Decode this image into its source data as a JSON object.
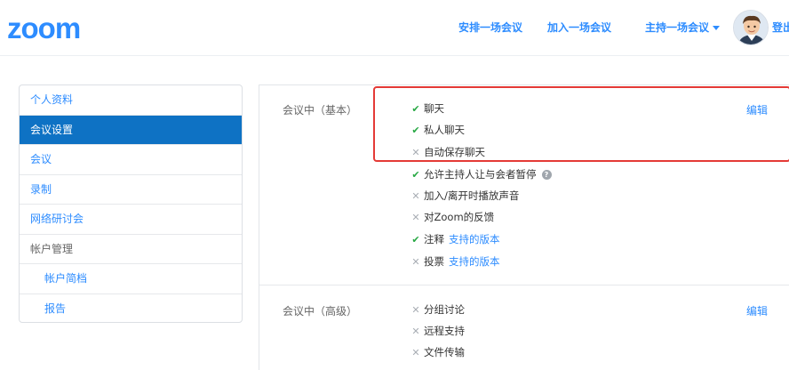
{
  "header": {
    "logo": "zoom",
    "nav": {
      "schedule": "安排一场会议",
      "join": "加入一场会议",
      "host": "主持一场会议"
    },
    "login": "登出"
  },
  "sidebar": {
    "items": [
      {
        "label": "个人资料"
      },
      {
        "label": "会议设置"
      },
      {
        "label": "会议"
      },
      {
        "label": "录制"
      },
      {
        "label": "网络研讨会"
      },
      {
        "label": "帐户管理"
      },
      {
        "label": "帐户简档"
      },
      {
        "label": "报告"
      }
    ]
  },
  "sections": {
    "basic": {
      "title": "会议中（基本）",
      "edit": "编辑",
      "options": [
        {
          "label": "聊天",
          "enabled": true
        },
        {
          "label": "私人聊天",
          "enabled": true
        },
        {
          "label": "自动保存聊天",
          "enabled": false
        },
        {
          "label": "允许主持人让与会者暂停",
          "enabled": true
        },
        {
          "label": "加入/离开时播放声音",
          "enabled": false
        },
        {
          "label": "对Zoom的反馈",
          "enabled": false
        },
        {
          "label": "注释",
          "enabled": true,
          "link": "支持的版本"
        },
        {
          "label": "投票",
          "enabled": false,
          "link": "支持的版本"
        }
      ]
    },
    "advanced": {
      "title": "会议中（高级）",
      "edit": "编辑",
      "options": [
        {
          "label": "分组讨论",
          "enabled": false
        },
        {
          "label": "远程支持",
          "enabled": false
        },
        {
          "label": "文件传输",
          "enabled": false
        }
      ]
    }
  },
  "help_mark": "?",
  "colors": {
    "brand": "#2d8cff",
    "active_nav": "#0e72c4",
    "enabled_check": "#27a843",
    "highlight_border": "#e43a36"
  },
  "icons": {
    "enabled": "check-icon",
    "disabled": "cross-icon",
    "help": "question-icon",
    "host_menu": "chevron-down-icon"
  }
}
